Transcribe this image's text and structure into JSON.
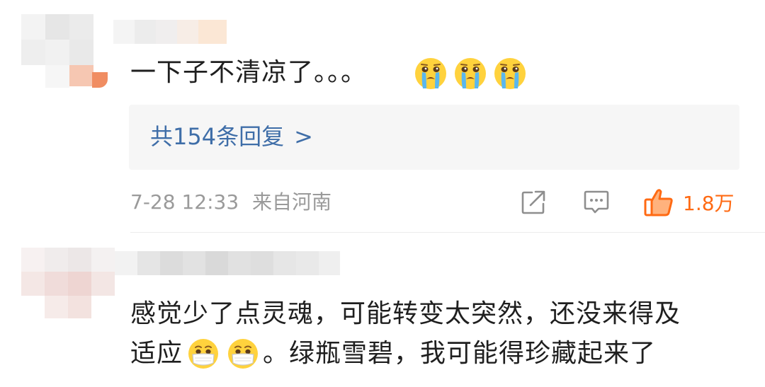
{
  "comments": [
    {
      "text": "一下子不清凉了。。。",
      "emojis": [
        "crying-face-emoji",
        "crying-face-emoji",
        "crying-face-emoji"
      ],
      "replies": {
        "label": "共154条回复",
        "arrow": ">"
      },
      "meta": {
        "time": "7-28 12:33",
        "location": "来自河南"
      },
      "actions": {
        "share_icon": "share-icon",
        "comment_icon": "comment-icon",
        "like_icon": "thumbs-up-icon",
        "like_count": "1.8万"
      }
    },
    {
      "line1": "感觉少了点灵魂，可能转变太突然，还没来得及",
      "line2_prefix": "适应",
      "line2_emojis": [
        "mask-face-emoji",
        "mask-face-emoji"
      ],
      "line2_suffix": "。绿瓶雪碧，我可能得珍藏起来了"
    }
  ],
  "colors": {
    "link": "#3f6ea8",
    "meta": "#9a9a9a",
    "like": "#ff6a13",
    "reply_bg": "#f6f6f6"
  }
}
